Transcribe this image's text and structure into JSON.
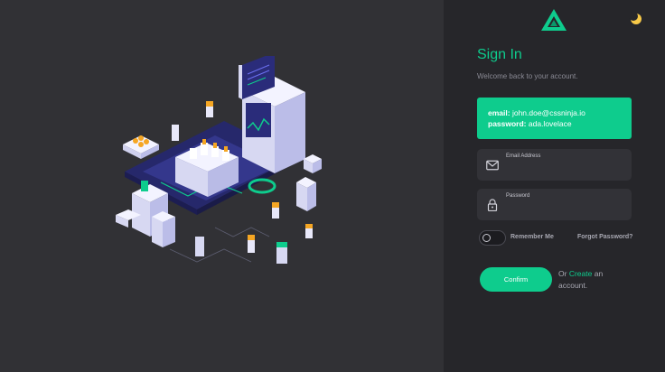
{
  "signin": {
    "title": "Sign In",
    "subtitle": "Welcome back to your account.",
    "alert": {
      "email_key": "email:",
      "email_value": "john.doe@cssninja.io",
      "password_key": "password:",
      "password_value": "ada.lovelace"
    },
    "email_label": "Email Address",
    "password_label": "Password",
    "remember_label": "Remember Me",
    "forgot_label": "Forgot Password?",
    "confirm_label": "Confirm",
    "or_text": "Or",
    "create_link": "Create",
    "account_text": "an account."
  },
  "icons": {
    "logo": "triangle-logo-icon",
    "theme_toggle": "moon-icon",
    "email": "envelope-icon",
    "password": "lock-icon"
  },
  "colors": {
    "accent": "#0ecc8d",
    "panel": "#26262a",
    "background": "#313135"
  }
}
